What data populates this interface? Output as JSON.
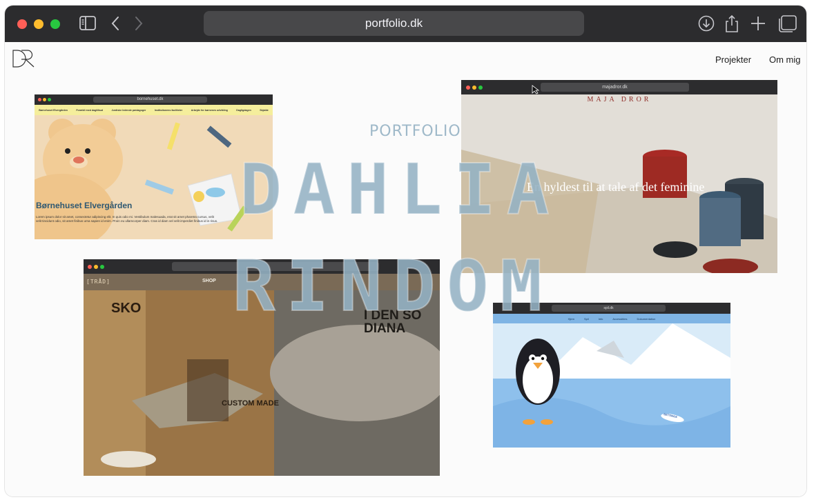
{
  "browser": {
    "url": "portfolio.dk",
    "traffic_lights": {
      "close": "#ff5f57",
      "minimize": "#febc2e",
      "zoom": "#28c840"
    }
  },
  "site": {
    "logo_text": "DR",
    "nav": [
      "Projekter",
      "Om mig"
    ],
    "hero_label": "PORTFOLIO",
    "hero_line1": "DAHLIA",
    "hero_line2": "RINDOM",
    "accent_color": "#9fb9c9"
  },
  "projects": {
    "bornehuset": {
      "url": "bornehuset.dk",
      "menu": [
        "Børnehuset Elvergården",
        "Forældi med dagtilbud",
        "Jurdiske ledende pædagoger",
        "Institutionens faciliteter",
        "Arbejde for børnenes udvikling",
        "Dagligdagen",
        "Skjalde"
      ],
      "title": "Børnehuset Elvergården",
      "body": "Lorem ipsum dolor sit amet, consectetur adipiscing elit. In quis odio mi. Vestibulum malesuada, erat sit amet pharetra cursus, velit velit tincidunt odio, sit amet finibus urna sapien id enim. Proin eu ullamcorper diam. Cras id diam vel velit imperdiet finibus id in risus."
    },
    "majadror": {
      "url": "majadror.dk",
      "brand": "MAJA DROR",
      "tagline": "En hyldest til at tale af det feminine"
    },
    "traad": {
      "brand": "[TRÅD]",
      "nav": "SHOP",
      "poster1": "SKO",
      "poster2": "I DEN SO DIANA",
      "sign": "CUSTOM MADE"
    },
    "spil": {
      "url": "spil.dk",
      "menu": [
        "Hjem",
        "Spil",
        "Info",
        "Accessibles",
        "Dokumentation"
      ],
      "settings_label": "SETTINGS"
    }
  }
}
